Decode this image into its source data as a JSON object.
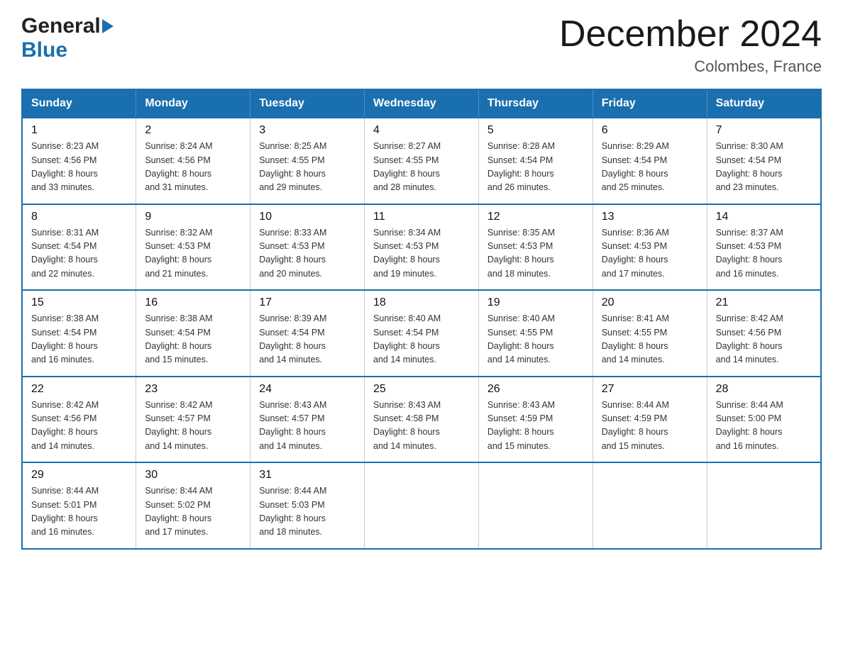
{
  "header": {
    "logo_general": "General",
    "logo_blue": "Blue",
    "month_title": "December 2024",
    "location": "Colombes, France"
  },
  "calendar": {
    "days_of_week": [
      "Sunday",
      "Monday",
      "Tuesday",
      "Wednesday",
      "Thursday",
      "Friday",
      "Saturday"
    ],
    "weeks": [
      [
        {
          "day": "1",
          "sunrise": "8:23 AM",
          "sunset": "4:56 PM",
          "daylight": "8 hours and 33 minutes."
        },
        {
          "day": "2",
          "sunrise": "8:24 AM",
          "sunset": "4:56 PM",
          "daylight": "8 hours and 31 minutes."
        },
        {
          "day": "3",
          "sunrise": "8:25 AM",
          "sunset": "4:55 PM",
          "daylight": "8 hours and 29 minutes."
        },
        {
          "day": "4",
          "sunrise": "8:27 AM",
          "sunset": "4:55 PM",
          "daylight": "8 hours and 28 minutes."
        },
        {
          "day": "5",
          "sunrise": "8:28 AM",
          "sunset": "4:54 PM",
          "daylight": "8 hours and 26 minutes."
        },
        {
          "day": "6",
          "sunrise": "8:29 AM",
          "sunset": "4:54 PM",
          "daylight": "8 hours and 25 minutes."
        },
        {
          "day": "7",
          "sunrise": "8:30 AM",
          "sunset": "4:54 PM",
          "daylight": "8 hours and 23 minutes."
        }
      ],
      [
        {
          "day": "8",
          "sunrise": "8:31 AM",
          "sunset": "4:54 PM",
          "daylight": "8 hours and 22 minutes."
        },
        {
          "day": "9",
          "sunrise": "8:32 AM",
          "sunset": "4:53 PM",
          "daylight": "8 hours and 21 minutes."
        },
        {
          "day": "10",
          "sunrise": "8:33 AM",
          "sunset": "4:53 PM",
          "daylight": "8 hours and 20 minutes."
        },
        {
          "day": "11",
          "sunrise": "8:34 AM",
          "sunset": "4:53 PM",
          "daylight": "8 hours and 19 minutes."
        },
        {
          "day": "12",
          "sunrise": "8:35 AM",
          "sunset": "4:53 PM",
          "daylight": "8 hours and 18 minutes."
        },
        {
          "day": "13",
          "sunrise": "8:36 AM",
          "sunset": "4:53 PM",
          "daylight": "8 hours and 17 minutes."
        },
        {
          "day": "14",
          "sunrise": "8:37 AM",
          "sunset": "4:53 PM",
          "daylight": "8 hours and 16 minutes."
        }
      ],
      [
        {
          "day": "15",
          "sunrise": "8:38 AM",
          "sunset": "4:54 PM",
          "daylight": "8 hours and 16 minutes."
        },
        {
          "day": "16",
          "sunrise": "8:38 AM",
          "sunset": "4:54 PM",
          "daylight": "8 hours and 15 minutes."
        },
        {
          "day": "17",
          "sunrise": "8:39 AM",
          "sunset": "4:54 PM",
          "daylight": "8 hours and 14 minutes."
        },
        {
          "day": "18",
          "sunrise": "8:40 AM",
          "sunset": "4:54 PM",
          "daylight": "8 hours and 14 minutes."
        },
        {
          "day": "19",
          "sunrise": "8:40 AM",
          "sunset": "4:55 PM",
          "daylight": "8 hours and 14 minutes."
        },
        {
          "day": "20",
          "sunrise": "8:41 AM",
          "sunset": "4:55 PM",
          "daylight": "8 hours and 14 minutes."
        },
        {
          "day": "21",
          "sunrise": "8:42 AM",
          "sunset": "4:56 PM",
          "daylight": "8 hours and 14 minutes."
        }
      ],
      [
        {
          "day": "22",
          "sunrise": "8:42 AM",
          "sunset": "4:56 PM",
          "daylight": "8 hours and 14 minutes."
        },
        {
          "day": "23",
          "sunrise": "8:42 AM",
          "sunset": "4:57 PM",
          "daylight": "8 hours and 14 minutes."
        },
        {
          "day": "24",
          "sunrise": "8:43 AM",
          "sunset": "4:57 PM",
          "daylight": "8 hours and 14 minutes."
        },
        {
          "day": "25",
          "sunrise": "8:43 AM",
          "sunset": "4:58 PM",
          "daylight": "8 hours and 14 minutes."
        },
        {
          "day": "26",
          "sunrise": "8:43 AM",
          "sunset": "4:59 PM",
          "daylight": "8 hours and 15 minutes."
        },
        {
          "day": "27",
          "sunrise": "8:44 AM",
          "sunset": "4:59 PM",
          "daylight": "8 hours and 15 minutes."
        },
        {
          "day": "28",
          "sunrise": "8:44 AM",
          "sunset": "5:00 PM",
          "daylight": "8 hours and 16 minutes."
        }
      ],
      [
        {
          "day": "29",
          "sunrise": "8:44 AM",
          "sunset": "5:01 PM",
          "daylight": "8 hours and 16 minutes."
        },
        {
          "day": "30",
          "sunrise": "8:44 AM",
          "sunset": "5:02 PM",
          "daylight": "8 hours and 17 minutes."
        },
        {
          "day": "31",
          "sunrise": "8:44 AM",
          "sunset": "5:03 PM",
          "daylight": "8 hours and 18 minutes."
        },
        null,
        null,
        null,
        null
      ]
    ],
    "sunrise_label": "Sunrise:",
    "sunset_label": "Sunset:",
    "daylight_label": "Daylight:"
  }
}
